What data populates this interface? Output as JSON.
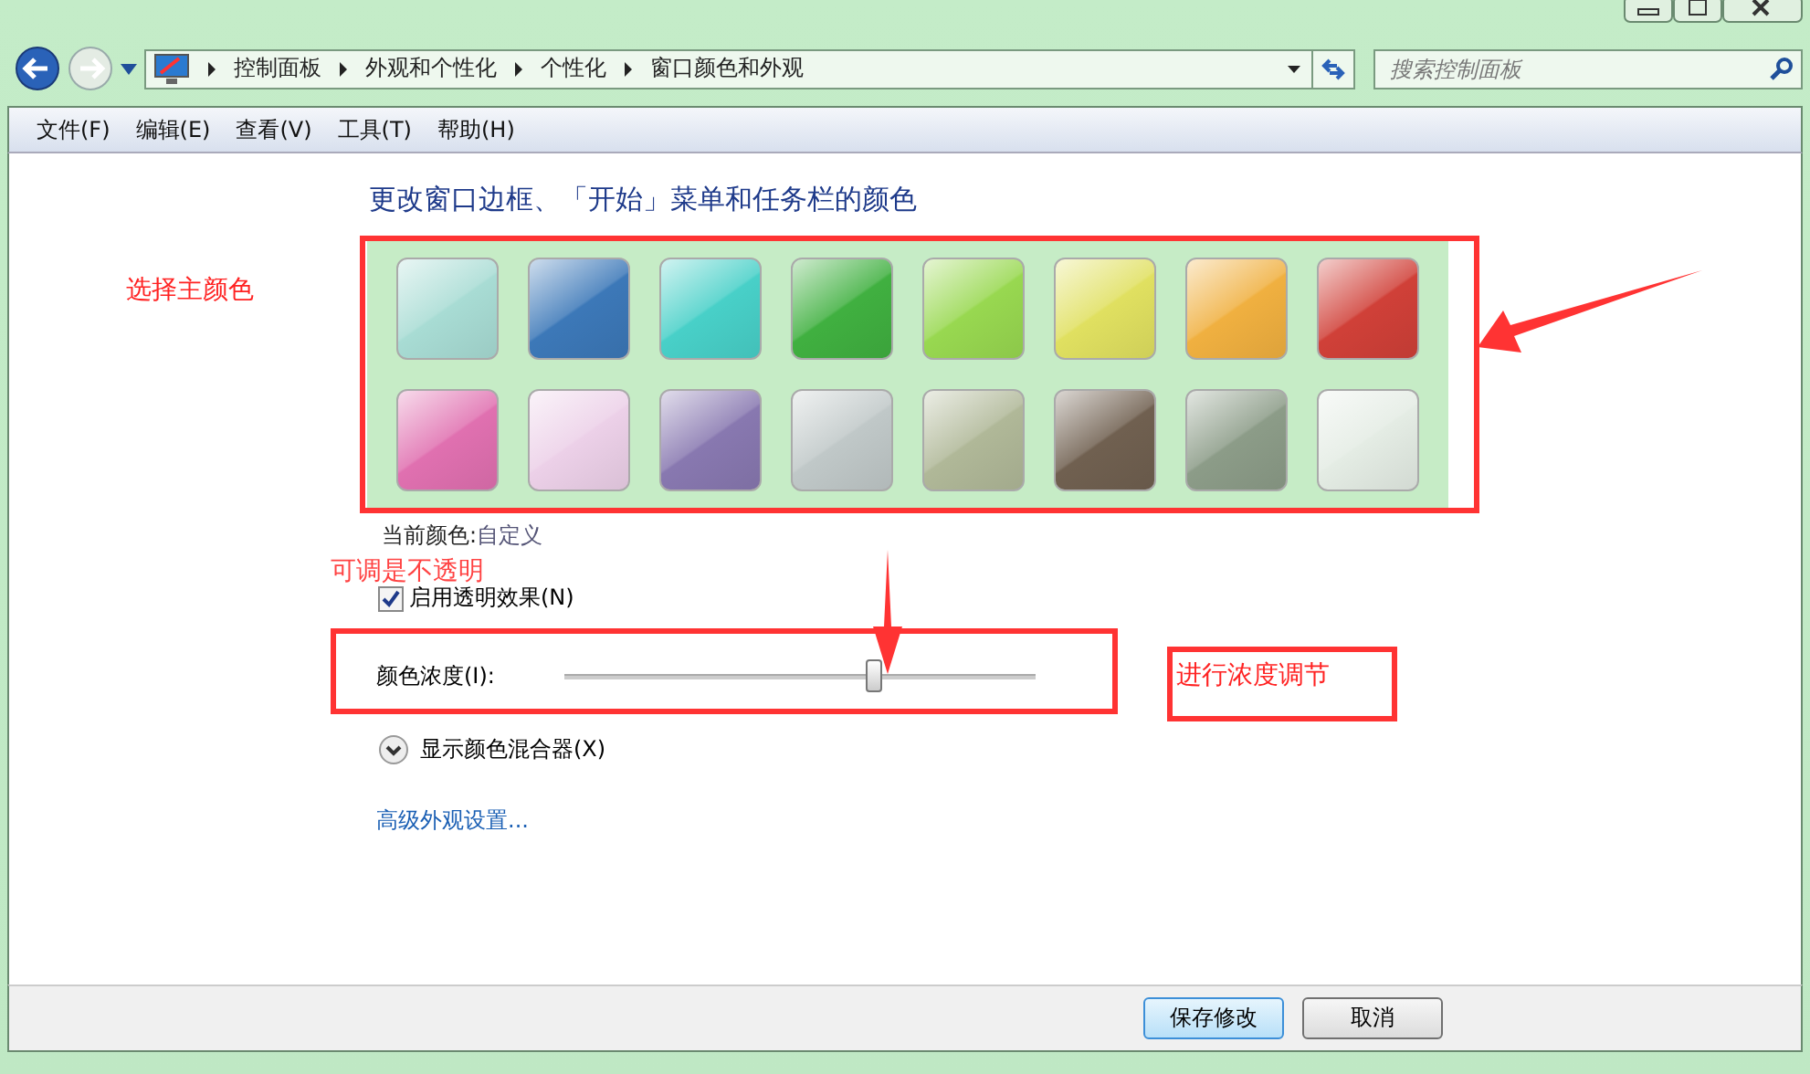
{
  "nav": {
    "breadcrumb": [
      "控制面板",
      "外观和个性化",
      "个性化",
      "窗口颜色和外观"
    ],
    "search": {
      "placeholder": "搜索控制面板"
    }
  },
  "menu": [
    "文件(F)",
    "编辑(E)",
    "查看(V)",
    "工具(T)",
    "帮助(H)"
  ],
  "heading": "更改窗口边框、「开始」菜单和任务栏的颜色",
  "swatches": [
    {
      "color": "#a8dcd4"
    },
    {
      "color": "#3c78b8"
    },
    {
      "color": "#48d0c8"
    },
    {
      "color": "#40b040"
    },
    {
      "color": "#98d850"
    },
    {
      "color": "#e0e060"
    },
    {
      "color": "#f0b040"
    },
    {
      "color": "#d04038"
    },
    {
      "color": "#e070b0"
    },
    {
      "color": "#ecd0e8"
    },
    {
      "color": "#8878b0"
    },
    {
      "color": "#c0c8c8"
    },
    {
      "color": "#b0b898"
    },
    {
      "color": "#706050"
    },
    {
      "color": "#8c9c88"
    },
    {
      "color": "#e4ece4"
    }
  ],
  "current_color": {
    "label": "当前颜色:",
    "value": "自定义"
  },
  "transparency": {
    "label": "启用透明效果(N)",
    "checked": true
  },
  "intensity": {
    "label": "颜色浓度(I):",
    "level": 0.66
  },
  "mixer": {
    "label": "显示颜色混合器(X)",
    "expanded": false
  },
  "advanced_link": "高级外观设置...",
  "buttons": [
    {
      "label": "保存修改",
      "default": true
    },
    {
      "label": "取消",
      "default": false
    }
  ],
  "annotations": {
    "choose_color": "选择主颜色",
    "transparency_note": "可调是不透明",
    "intensity_note": "进行浓度调节"
  }
}
